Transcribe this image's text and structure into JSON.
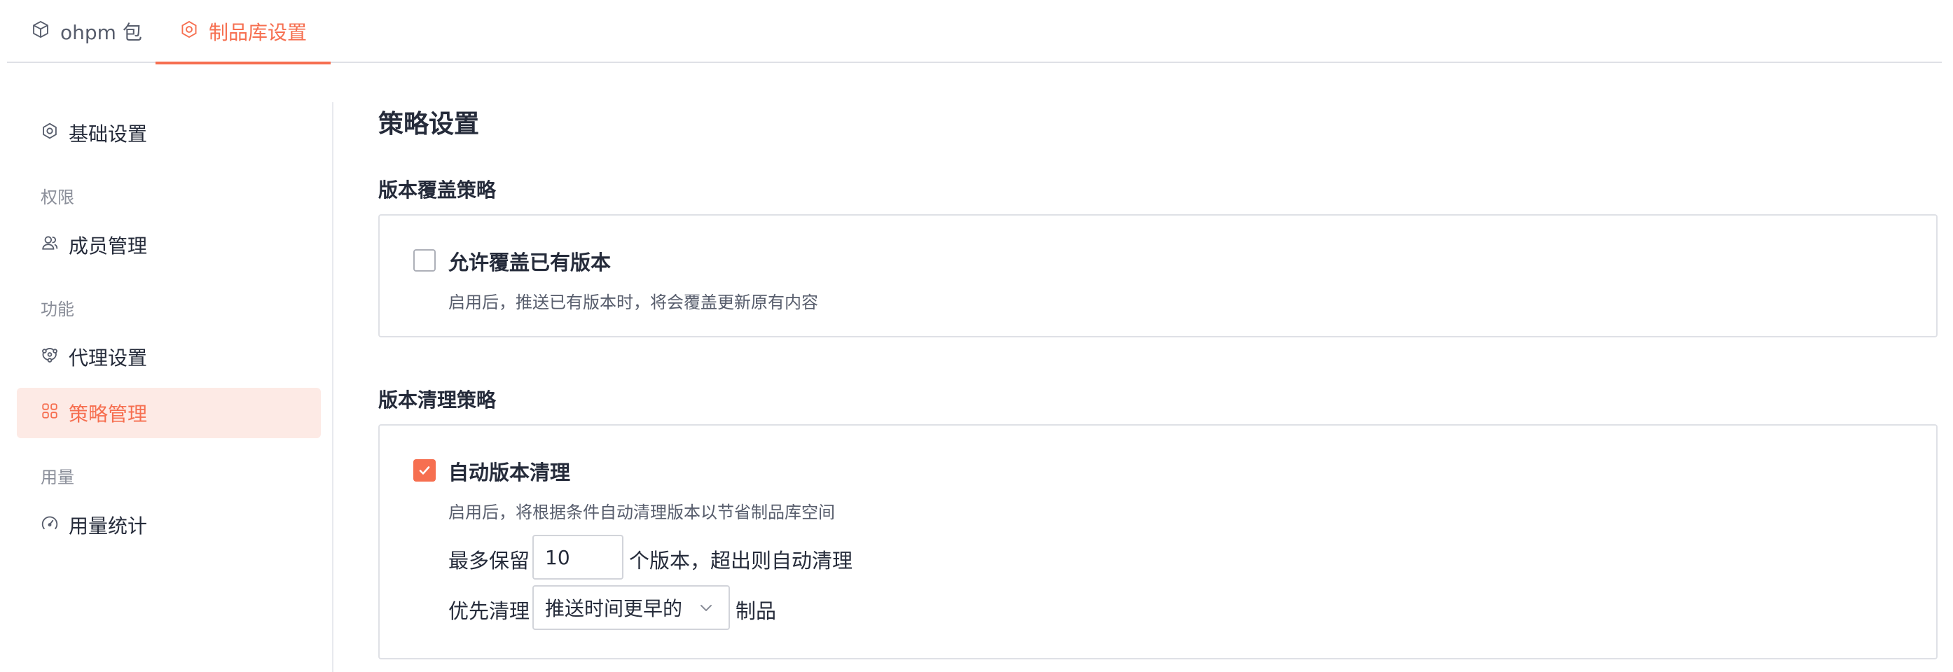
{
  "tabs": [
    {
      "label": "ohpm 包",
      "icon": "package-icon"
    },
    {
      "label": "制品库设置",
      "icon": "settings-icon",
      "active": true
    }
  ],
  "sidebar": {
    "items": [
      {
        "label": "基础设置",
        "icon": "settings-icon"
      },
      {
        "group": "权限"
      },
      {
        "label": "成员管理",
        "icon": "users-icon"
      },
      {
        "group": "功能"
      },
      {
        "label": "代理设置",
        "icon": "proxy-icon"
      },
      {
        "label": "策略管理",
        "icon": "grid-icon",
        "active": true
      },
      {
        "group": "用量"
      },
      {
        "label": "用量统计",
        "icon": "gauge-icon"
      }
    ]
  },
  "main": {
    "title": "策略设置",
    "overwrite": {
      "section_title": "版本覆盖策略",
      "label": "允许覆盖已有版本",
      "checked": false,
      "description": "启用后，推送已有版本时，将会覆盖更新原有内容"
    },
    "cleanup": {
      "section_title": "版本清理策略",
      "label": "自动版本清理",
      "checked": true,
      "description": "启用后，将根据条件自动清理版本以节省制品库空间",
      "keep_prefix": "最多保留",
      "keep_value": "10",
      "keep_suffix": "个版本，超出则自动清理",
      "priority_prefix": "优先清理",
      "priority_value": "推送时间更早的",
      "priority_suffix": "制品"
    }
  },
  "colors": {
    "accent": "#f66f50",
    "active_bg": "#fdeae5",
    "border": "#dfe1e6",
    "text": "#252b3a",
    "muted": "#8a8e99"
  }
}
